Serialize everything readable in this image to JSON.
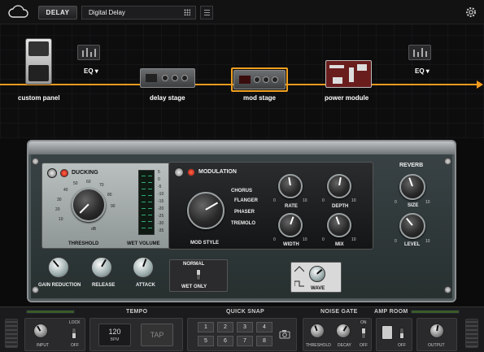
{
  "topbar": {
    "category_label": "DELAY",
    "preset_name": "Digital Delay"
  },
  "chain": {
    "custom_panel": "custom panel",
    "eq_left": "EQ",
    "delay_stage": "delay stage",
    "mod_stage": "mod stage",
    "power_module": "power module",
    "eq_right": "EQ"
  },
  "ducking": {
    "title": "DUCKING",
    "threshold_label": "THRESHOLD",
    "wet_volume_label": "WET VOLUME",
    "threshold_scale": [
      "10",
      "20",
      "30",
      "40",
      "50",
      "60",
      "70",
      "80",
      "90",
      "dB"
    ],
    "meter_scale": [
      "5",
      "0",
      "-5",
      "-10",
      "-15",
      "-20",
      "-25",
      "-30",
      "-35"
    ]
  },
  "modulation": {
    "title": "MODULATION",
    "mod_style_label": "MOD STYLE",
    "styles": [
      "CHORUS",
      "FLANGER",
      "PHASER",
      "TREMOLO"
    ],
    "rate_label": "RATE",
    "depth_label": "DEPTH",
    "width_label": "WIDTH",
    "mix_label": "MIX",
    "knob_min": "0",
    "knob_max": "10"
  },
  "reverb": {
    "title": "REVERB",
    "size_label": "SIZE",
    "level_label": "LEVEL",
    "knob_min": "0",
    "knob_max": "10"
  },
  "lower_controls": {
    "gain_reduction": "GAIN REDUCTION",
    "release": "RELEASE",
    "attack": "ATTACK",
    "normal": "NORMAL",
    "wet_only": "WET ONLY",
    "wave": "WAVE"
  },
  "bottom": {
    "input_label": "INPUT",
    "lock_label": "LOCK",
    "off_label": "OFF",
    "tempo_title": "TEMPO",
    "bpm_value": "120",
    "bpm_unit": "BPM",
    "tap_label": "TAP",
    "quick_snap_title": "QUICK SNAP",
    "snaps": [
      "1",
      "2",
      "3",
      "4",
      "5",
      "6",
      "7",
      "8"
    ],
    "noise_gate_title": "NOISE GATE",
    "threshold_label": "THRESHOLD",
    "decay_label": "DECAY",
    "on_label": "ON",
    "gate_off_label": "OFF",
    "amp_room_title": "AMP ROOM",
    "amp_off_label": "OFF",
    "output_label": "OUTPUT"
  },
  "colors": {
    "signal_path": "#f39a1e",
    "selected_stage": "#f0a020",
    "led_red": "#d8261c"
  }
}
